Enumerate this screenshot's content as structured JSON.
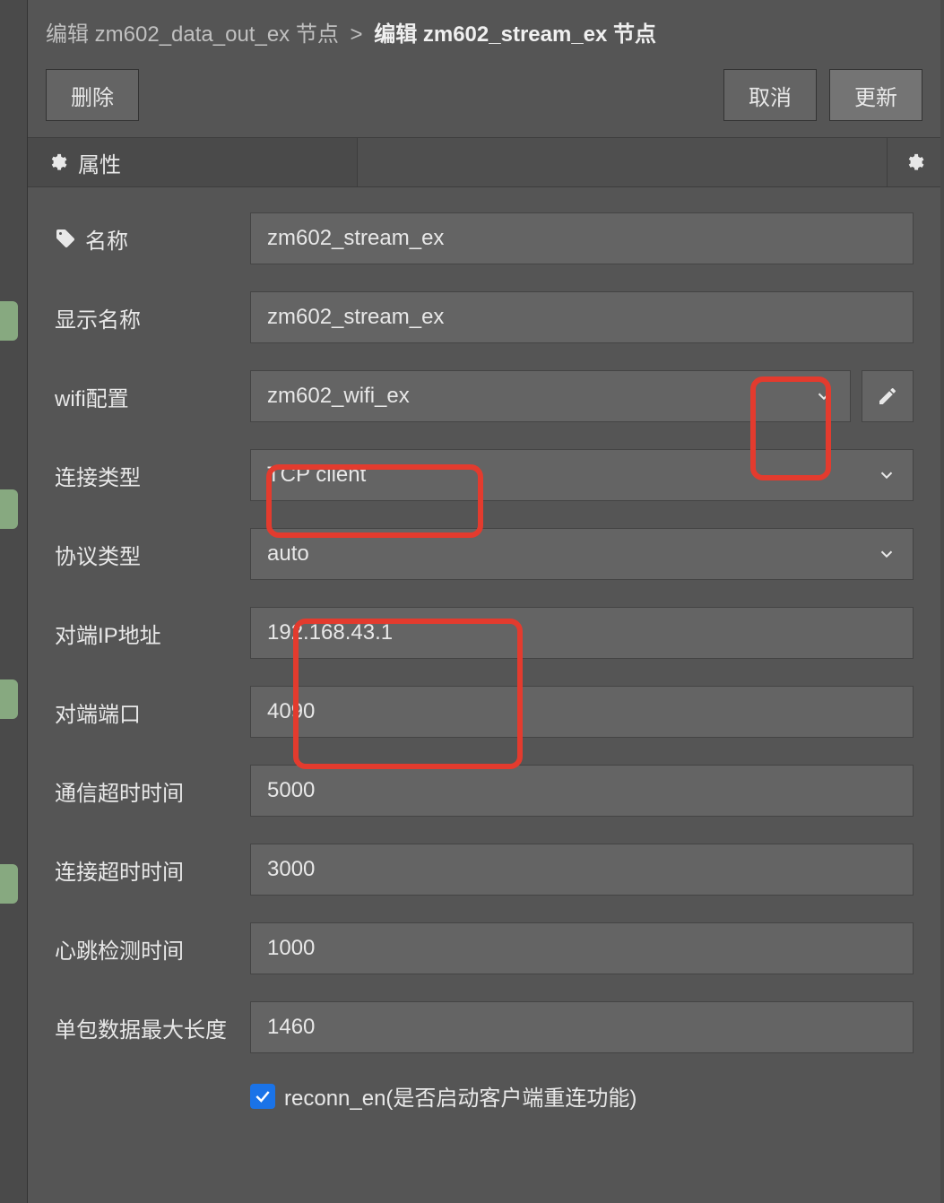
{
  "breadcrumb": {
    "parent": "编辑 zm602_data_out_ex 节点",
    "sep": ">",
    "current": "编辑 zm602_stream_ex 节点"
  },
  "toolbar": {
    "delete_label": "删除",
    "cancel_label": "取消",
    "update_label": "更新"
  },
  "tab": {
    "label": "属性"
  },
  "form": {
    "name_label": "名称",
    "name_value": "zm602_stream_ex",
    "display_label": "显示名称",
    "display_value": "zm602_stream_ex",
    "wifi_label": "wifi配置",
    "wifi_value": "zm602_wifi_ex",
    "conn_label": "连接类型",
    "conn_value": "TCP client",
    "proto_label": "协议类型",
    "proto_value": "auto",
    "peer_ip_label": "对端IP地址",
    "peer_ip_value": "192.168.43.1",
    "peer_port_label": "对端端口",
    "peer_port_value": "4090",
    "comm_timeout_label": "通信超时时间",
    "comm_timeout_value": "5000",
    "conn_timeout_label": "连接超时时间",
    "conn_timeout_value": "3000",
    "heartbeat_label": "心跳检测时间",
    "heartbeat_value": "1000",
    "maxlen_label": "单包数据最大长度",
    "maxlen_value": "1460",
    "reconn_label": "reconn_en(是否启动客户端重连功能)"
  }
}
